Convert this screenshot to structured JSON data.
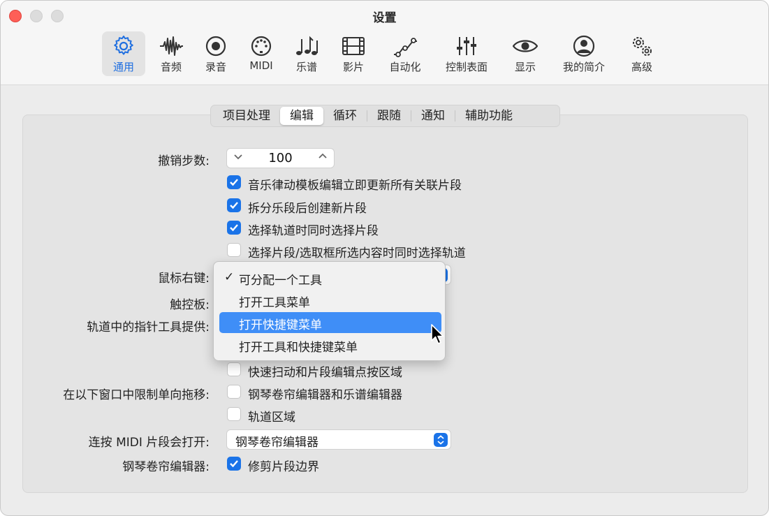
{
  "window": {
    "title": "设置"
  },
  "toolbar": {
    "items": [
      {
        "label": "通用",
        "icon": "gear-icon"
      },
      {
        "label": "音频",
        "icon": "waveform-icon"
      },
      {
        "label": "录音",
        "icon": "record-icon"
      },
      {
        "label": "MIDI",
        "icon": "midi-connector-icon"
      },
      {
        "label": "乐谱",
        "icon": "music-notes-icon"
      },
      {
        "label": "影片",
        "icon": "film-icon"
      },
      {
        "label": "自动化",
        "icon": "automation-curve-icon"
      },
      {
        "label": "控制表面",
        "icon": "sliders-icon"
      },
      {
        "label": "显示",
        "icon": "eye-icon"
      },
      {
        "label": "我的简介",
        "icon": "person-icon"
      },
      {
        "label": "高级",
        "icon": "gears-icon"
      }
    ],
    "selected": "通用"
  },
  "tabs": {
    "items": [
      "项目处理",
      "编辑",
      "循环",
      "跟随",
      "通知",
      "辅助功能"
    ],
    "selected": "编辑"
  },
  "settings": {
    "undo_label": "撤销步数:",
    "undo_value": "100",
    "cb1": "音乐律动模板编辑立即更新所有关联片段",
    "cb2": "拆分乐段后创建新片段",
    "cb3": "选择轨道时同时选择片段",
    "cb4": "选择片段/选取框所选内容时同时选择轨道",
    "right_click_label": "鼠标右键:",
    "trackpad_label": "触控板:",
    "pointer_label": "轨道中的指针工具提供:",
    "cb5": "快速扫动和片段编辑点按区域",
    "limit_drag_label": "在以下窗口中限制单向拖移:",
    "cb6": "钢琴卷帘编辑器和乐谱编辑器",
    "cb7": "轨道区域",
    "double_click_label": "连按 MIDI 片段会打开:",
    "double_click_value": "钢琴卷帘编辑器",
    "piano_roll_label": "钢琴卷帘编辑器:",
    "cb8": "修剪片段边界"
  },
  "checkbox_states": {
    "cb1": true,
    "cb2": true,
    "cb3": true,
    "cb4": false,
    "cb5": false,
    "cb6": false,
    "cb7": false,
    "cb8": true
  },
  "menu": {
    "items": [
      "可分配一个工具",
      "打开工具菜单",
      "打开快捷键菜单",
      "打开工具和快捷键菜单"
    ],
    "checked": "可分配一个工具",
    "highlighted": "打开快捷键菜单"
  },
  "colors": {
    "accent": "#1a73e8",
    "menu_highlight": "#3f8ef7",
    "close": "#fe5f57"
  }
}
